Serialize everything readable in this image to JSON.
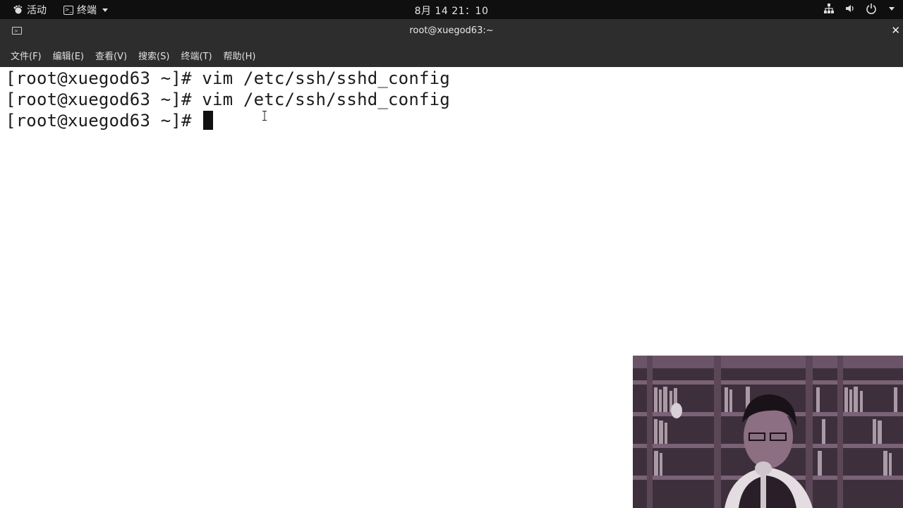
{
  "topbar": {
    "activities_label": "活动",
    "app_label": "终端",
    "clock": "8月 14 21：10",
    "tray_icons": [
      "network-icon",
      "volume-icon",
      "power-icon",
      "chevron-down-icon"
    ]
  },
  "window": {
    "title": "root@xuegod63:~",
    "close_glyph": "✕"
  },
  "menubar": {
    "items": [
      "文件(F)",
      "编辑(E)",
      "查看(V)",
      "搜索(S)",
      "终端(T)",
      "帮助(H)"
    ]
  },
  "terminal": {
    "lines": [
      "[root@xuegod63 ~]# vim /etc/ssh/sshd_config",
      "[root@xuegod63 ~]# vim /etc/ssh/sshd_config",
      "[root@xuegod63 ~]# "
    ]
  },
  "colors": {
    "topbar_bg": "#0f0f0f",
    "titlebar_bg": "#2d2d2d",
    "terminal_bg": "#ffffff",
    "terminal_fg": "#1b1b1b",
    "webcam_tint": "#4a3848"
  }
}
